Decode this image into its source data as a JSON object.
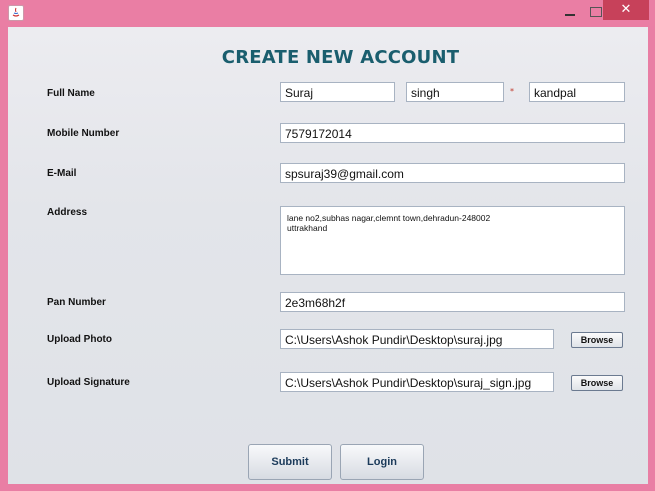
{
  "window": {
    "close_glyph": "✕"
  },
  "page": {
    "heading": "CREATE NEW ACCOUNT"
  },
  "form": {
    "full_name": {
      "label": "Full Name",
      "first": "Suraj",
      "middle": "singh",
      "last": "kandpal",
      "required_marker": "*"
    },
    "mobile": {
      "label": "Mobile Number",
      "value": "7579172014"
    },
    "email": {
      "label": "E-Mail",
      "value": "spsuraj39@gmail.com"
    },
    "address": {
      "label": "Address",
      "value": "lane no2,subhas nagar,clemnt town,dehradun-248002\nuttrakhand"
    },
    "pan": {
      "label": "Pan Number",
      "value": "2e3m68h2f"
    },
    "photo": {
      "label": "Upload Photo",
      "value": "C:\\Users\\Ashok Pundir\\Desktop\\suraj.jpg",
      "browse_label": "Browse"
    },
    "signature": {
      "label": "Upload Signature",
      "value": "C:\\Users\\Ashok Pundir\\Desktop\\suraj_sign.jpg",
      "browse_label": "Browse"
    }
  },
  "actions": {
    "submit_label": "Submit",
    "login_label": "Login"
  }
}
